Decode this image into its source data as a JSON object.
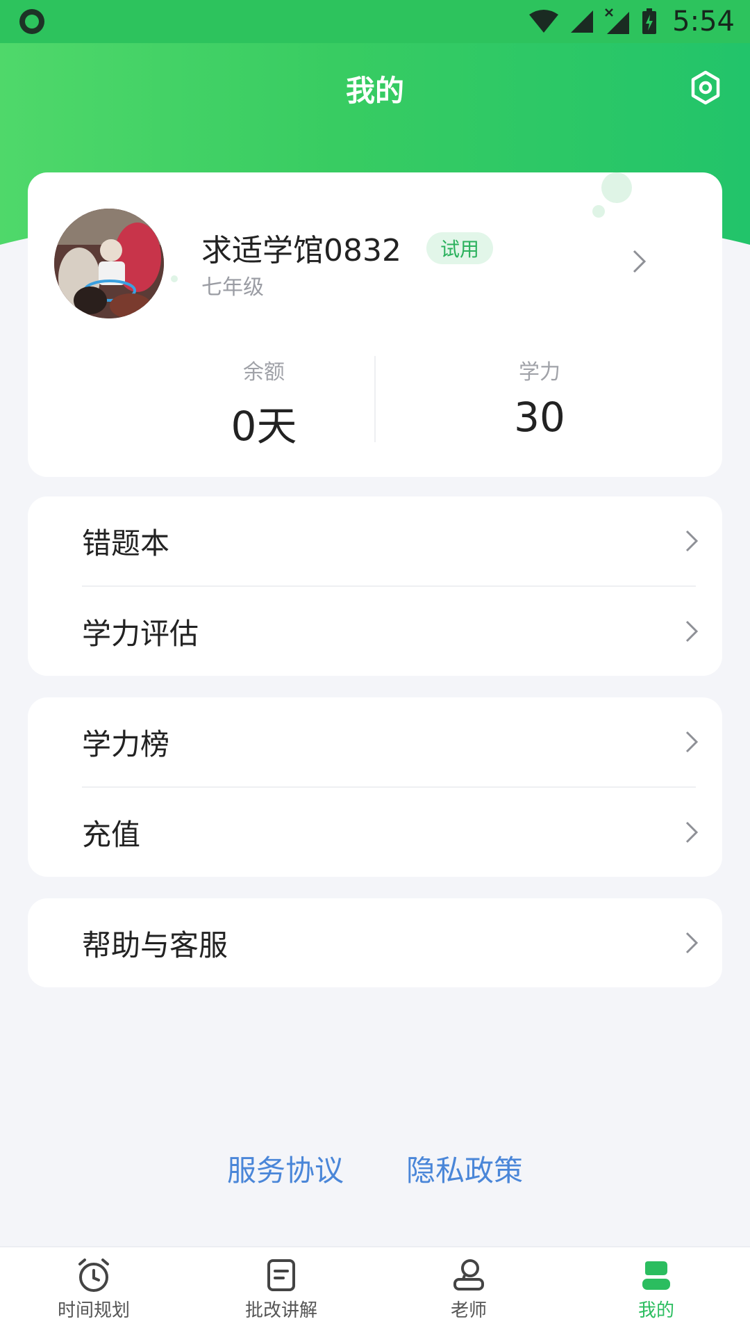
{
  "status_bar": {
    "time": "5:54"
  },
  "header": {
    "title": "我的"
  },
  "profile": {
    "name": "求适学馆0832",
    "badge": "试用",
    "grade": "七年级",
    "stats": [
      {
        "label": "余额",
        "value": "0天"
      },
      {
        "label": "学力",
        "value": "30"
      }
    ]
  },
  "menu_groups": [
    {
      "items": [
        {
          "label": "错题本"
        },
        {
          "label": "学力评估"
        }
      ]
    },
    {
      "items": [
        {
          "label": "学力榜"
        },
        {
          "label": "充值"
        }
      ]
    },
    {
      "items": [
        {
          "label": "帮助与客服"
        }
      ]
    }
  ],
  "footer": {
    "links": [
      {
        "label": "服务协议"
      },
      {
        "label": "隐私政策"
      }
    ]
  },
  "bottom_nav": {
    "items": [
      {
        "label": "时间规划",
        "icon": "alarm-clock-icon"
      },
      {
        "label": "批改讲解",
        "icon": "document-icon"
      },
      {
        "label": "老师",
        "icon": "teacher-icon"
      },
      {
        "label": "我的",
        "icon": "user-icon",
        "active": true
      }
    ]
  },
  "colors": {
    "accent": "#2bbd5f",
    "link": "#4a86d8",
    "background": "#f4f5f9"
  }
}
